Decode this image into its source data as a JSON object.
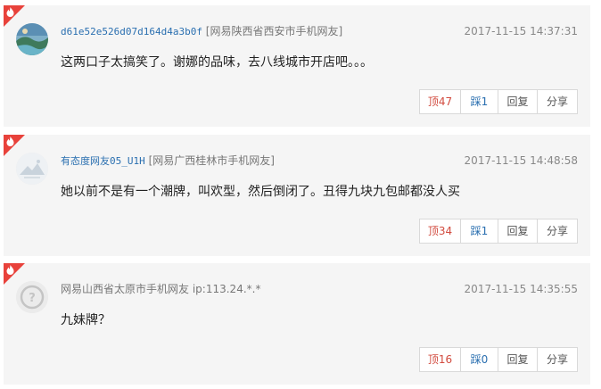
{
  "comments": [
    {
      "user": "d61e52e526d07d164d4a3b0f",
      "location": "[网易陕西省西安市手机网友]",
      "time": "2017-11-15 14:37:31",
      "content": "这两口子太搞笑了。谢娜的品味，去八线城市开店吧。。。",
      "up": "顶47",
      "down": "踩1",
      "reply": "回复",
      "share": "分享",
      "hot_badge": true,
      "avatar": "landscape-avatar"
    },
    {
      "user": "有态度网友05_U1H",
      "location": "[网易广西桂林市手机网友]",
      "time": "2017-11-15 14:48:58",
      "content": "她以前不是有一个潮牌，叫欢型，然后倒闭了。丑得九块九包邮都没人买",
      "up": "顶34",
      "down": "踩1",
      "reply": "回复",
      "share": "分享",
      "hot_badge": true,
      "avatar": "mountain-default-avatar"
    },
    {
      "user": "网易山西省太原市手机网友",
      "location": "ip:113.24.*.*",
      "time": "2017-11-15 14:35:55",
      "content": "九妹牌？",
      "up": "顶16",
      "down": "踩0",
      "reply": "回复",
      "share": "分享",
      "hot_badge": true,
      "avatar": "anonymous-avatar"
    }
  ],
  "colors": {
    "hot_badge": "#e8423b",
    "username_link": "#2a6fb0",
    "upvote": "#d24b3f",
    "card_bg": "#f5f5f5"
  }
}
